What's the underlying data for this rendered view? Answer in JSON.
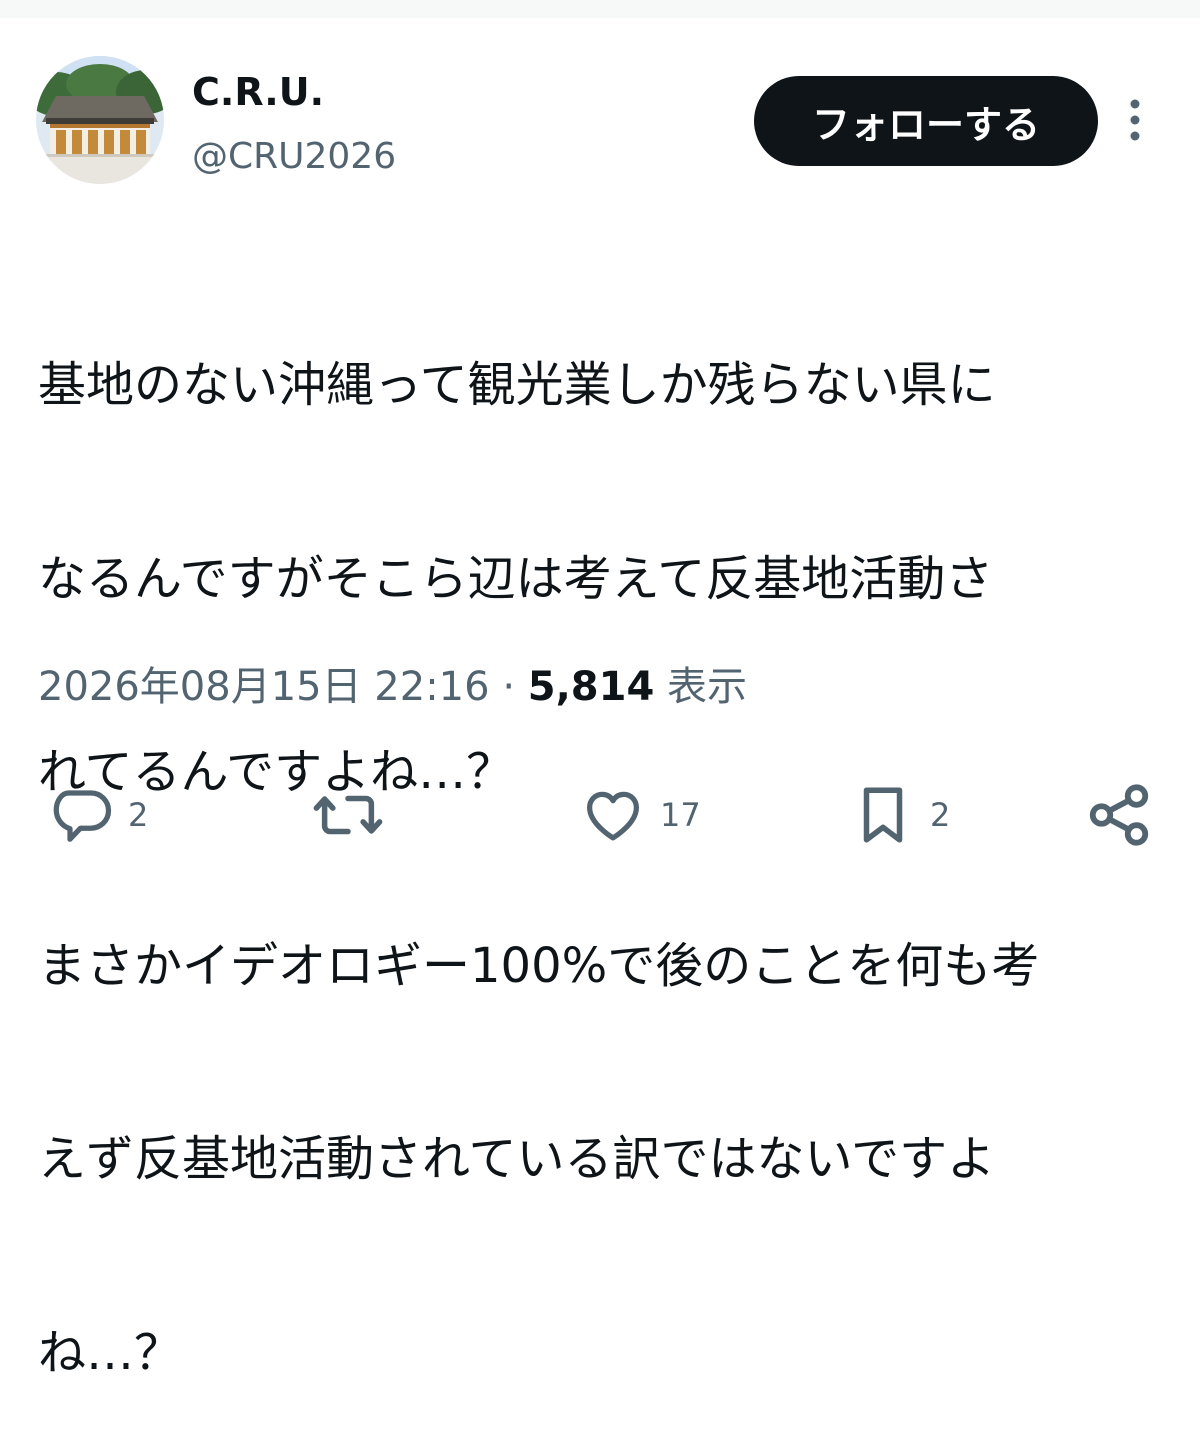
{
  "user": {
    "display_name": "C.R.U.",
    "handle": "@CRU2026"
  },
  "follow_label": "フォローする",
  "tweet": {
    "lines": [
      "基地のない沖縄って観光業しか残らない県に",
      "なるんですがそこら辺は考えて反基地活動さ",
      "れてるんですよね…？",
      "まさかイデオロギー100%で後のことを何も考",
      "えず反基地活動されている訳ではないですよ",
      "ね…？"
    ]
  },
  "meta": {
    "timestamp": "2026年08月15日 22:16",
    "separator": "·",
    "views_count": "5,814",
    "views_label": "表示"
  },
  "actions": {
    "reply_count": "2",
    "retweet_count": "",
    "like_count": "17",
    "bookmark_count": "2"
  },
  "icons": {
    "avatar": "shrine-photo-avatar",
    "more": "more-vertical-icon",
    "reply": "reply-icon",
    "retweet": "retweet-icon",
    "like": "heart-icon",
    "bookmark": "bookmark-icon",
    "share": "share-icon"
  },
  "colors": {
    "text_primary": "#0f1419",
    "text_secondary": "#536471",
    "follow_bg": "#0f1419",
    "follow_text": "#ffffff"
  }
}
